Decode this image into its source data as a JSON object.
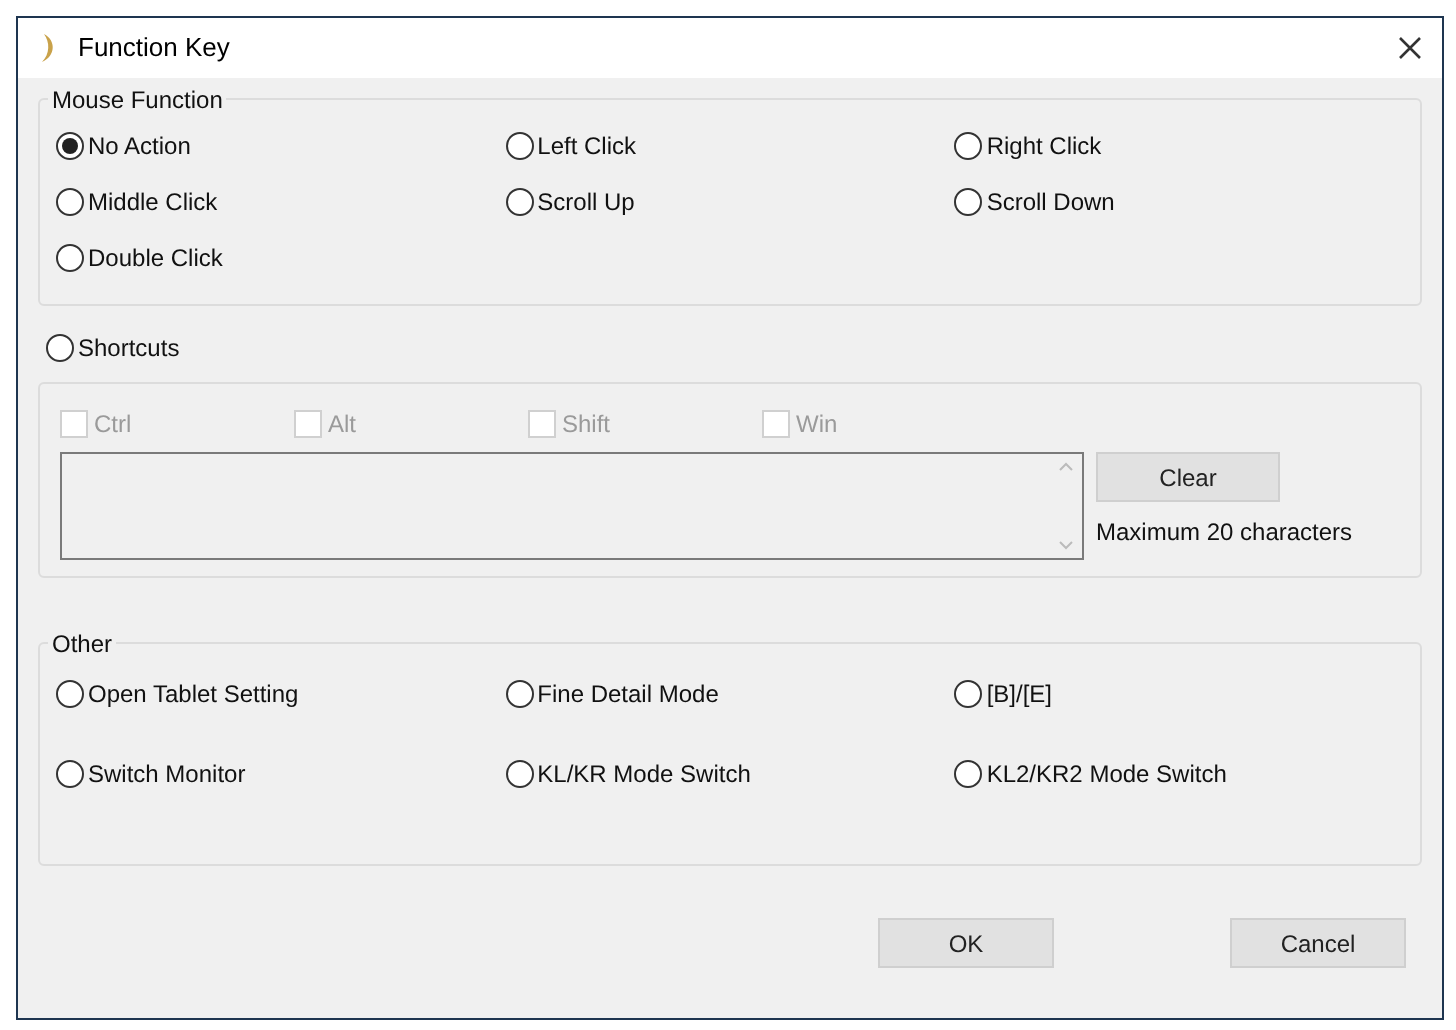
{
  "window": {
    "title": "Function Key"
  },
  "mouse_function": {
    "label": "Mouse Function",
    "options": [
      {
        "label": "No Action",
        "selected": true
      },
      {
        "label": "Left Click",
        "selected": false
      },
      {
        "label": "Right Click",
        "selected": false
      },
      {
        "label": "Middle Click",
        "selected": false
      },
      {
        "label": "Scroll Up",
        "selected": false
      },
      {
        "label": "Scroll Down",
        "selected": false
      },
      {
        "label": "Double Click",
        "selected": false
      }
    ]
  },
  "shortcuts": {
    "label": "Shortcuts",
    "selected": false,
    "disabled": true,
    "modifiers": [
      {
        "label": "Ctrl",
        "checked": false
      },
      {
        "label": "Alt",
        "checked": false
      },
      {
        "label": "Shift",
        "checked": false
      },
      {
        "label": "Win",
        "checked": false
      }
    ],
    "clear_button": "Clear",
    "hint": "Maximum 20 characters"
  },
  "other": {
    "label": "Other",
    "options": [
      {
        "label": "Open Tablet Setting",
        "selected": false
      },
      {
        "label": "Fine Detail Mode",
        "selected": false
      },
      {
        "label": "[B]/[E]",
        "selected": false
      },
      {
        "label": "Switch Monitor",
        "selected": false
      },
      {
        "label": "KL/KR Mode Switch",
        "selected": false
      },
      {
        "label": "KL2/KR2 Mode Switch",
        "selected": false
      }
    ]
  },
  "buttons": [
    "OK",
    "Cancel"
  ]
}
